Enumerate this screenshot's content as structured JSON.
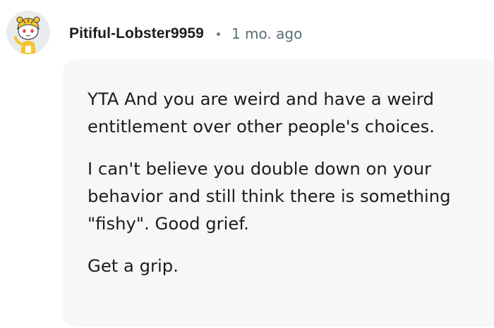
{
  "comment": {
    "author": "Pitiful-Lobster9959",
    "separator": "•",
    "timestamp": "1 mo. ago",
    "paragraphs": [
      {
        "line1": "YTA And you are weird and have a weird",
        "line2": "entitlement over other people's choices."
      },
      {
        "line1": "I can't believe you double down on your",
        "line2": "behavior and still think there is something",
        "line3": "\"fishy\". Good grief."
      },
      {
        "line1": "Get a grip."
      }
    ]
  },
  "avatar": {
    "icon": "snoo-avatar-icon",
    "background": "#e9ecee",
    "accent": "#f4c430"
  },
  "colors": {
    "text": "#1c1c1c",
    "meta": "#576f76",
    "bubble": "#f6f7f8"
  }
}
